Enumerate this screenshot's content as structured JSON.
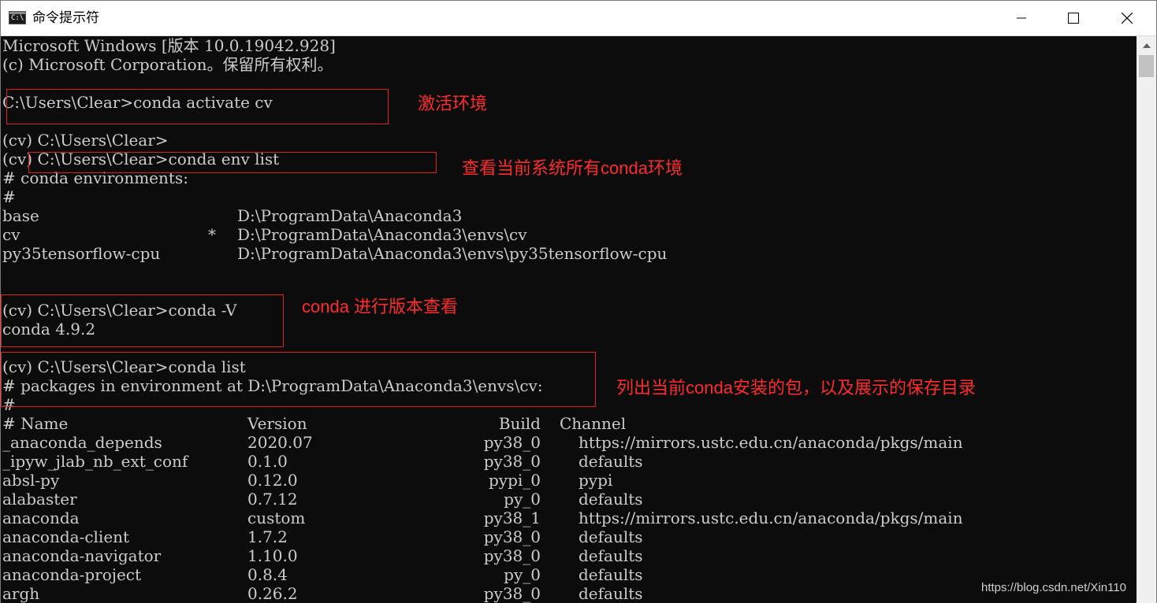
{
  "window": {
    "title": "命令提示符",
    "icon_text": "C:\\",
    "controls": [
      "minimize-icon",
      "maximize-icon",
      "close-icon"
    ]
  },
  "terminal": {
    "lines": [
      {
        "row": 0,
        "text": "Microsoft Windows [版本 10.0.19042.928]"
      },
      {
        "row": 1,
        "text": "(c) Microsoft Corporation。保留所有权利。"
      },
      {
        "row": 3,
        "text": "C:\\Users\\Clear>conda activate cv"
      },
      {
        "row": 5,
        "text": "(cv) C:\\Users\\Clear>"
      },
      {
        "row": 6,
        "text": "(cv) C:\\Users\\Clear>conda env list"
      },
      {
        "row": 7,
        "text": "# conda environments:"
      },
      {
        "row": 8,
        "text": "#"
      },
      {
        "row": 14,
        "text": "(cv) C:\\Users\\Clear>conda -V"
      },
      {
        "row": 15,
        "text": "conda 4.9.2"
      },
      {
        "row": 17,
        "text": "(cv) C:\\Users\\Clear>conda list"
      },
      {
        "row": 18,
        "text": "# packages in environment at D:\\ProgramData\\Anaconda3\\envs\\cv:"
      },
      {
        "row": 19,
        "text": "#"
      }
    ],
    "environments": [
      {
        "name": "base",
        "active": "",
        "path": "D:\\ProgramData\\Anaconda3"
      },
      {
        "name": "cv",
        "active": "*",
        "path": "D:\\ProgramData\\Anaconda3\\envs\\cv"
      },
      {
        "name": "py35tensorflow-cpu",
        "active": "",
        "path": "D:\\ProgramData\\Anaconda3\\envs\\py35tensorflow-cpu"
      }
    ],
    "package_headers": {
      "name": "# Name",
      "version": "Version",
      "build": "Build",
      "channel": "Channel"
    },
    "packages": [
      {
        "name": "_anaconda_depends",
        "version": "2020.07",
        "build": "py38_0",
        "channel": "https://mirrors.ustc.edu.cn/anaconda/pkgs/main"
      },
      {
        "name": "_ipyw_jlab_nb_ext_conf",
        "version": "0.1.0",
        "build": "py38_0",
        "channel": "defaults"
      },
      {
        "name": "absl-py",
        "version": "0.12.0",
        "build": "pypi_0",
        "channel": "pypi"
      },
      {
        "name": "alabaster",
        "version": "0.7.12",
        "build": "py_0",
        "channel": "defaults"
      },
      {
        "name": "anaconda",
        "version": "custom",
        "build": "py38_1",
        "channel": "https://mirrors.ustc.edu.cn/anaconda/pkgs/main"
      },
      {
        "name": "anaconda-client",
        "version": "1.7.2",
        "build": "py38_0",
        "channel": "defaults"
      },
      {
        "name": "anaconda-navigator",
        "version": "1.10.0",
        "build": "py38_0",
        "channel": "defaults"
      },
      {
        "name": "anaconda-project",
        "version": "0.8.4",
        "build": "py_0",
        "channel": "defaults"
      },
      {
        "name": "argh",
        "version": "0.26.2",
        "build": "py38_0",
        "channel": "defaults"
      }
    ]
  },
  "annotations": [
    "激活环境",
    "查看当前系统所有conda环境",
    "conda 进行版本查看",
    "列出当前conda安装的包，以及展示的保存目录"
  ],
  "watermark": "https://blog.csdn.net/Xin110"
}
